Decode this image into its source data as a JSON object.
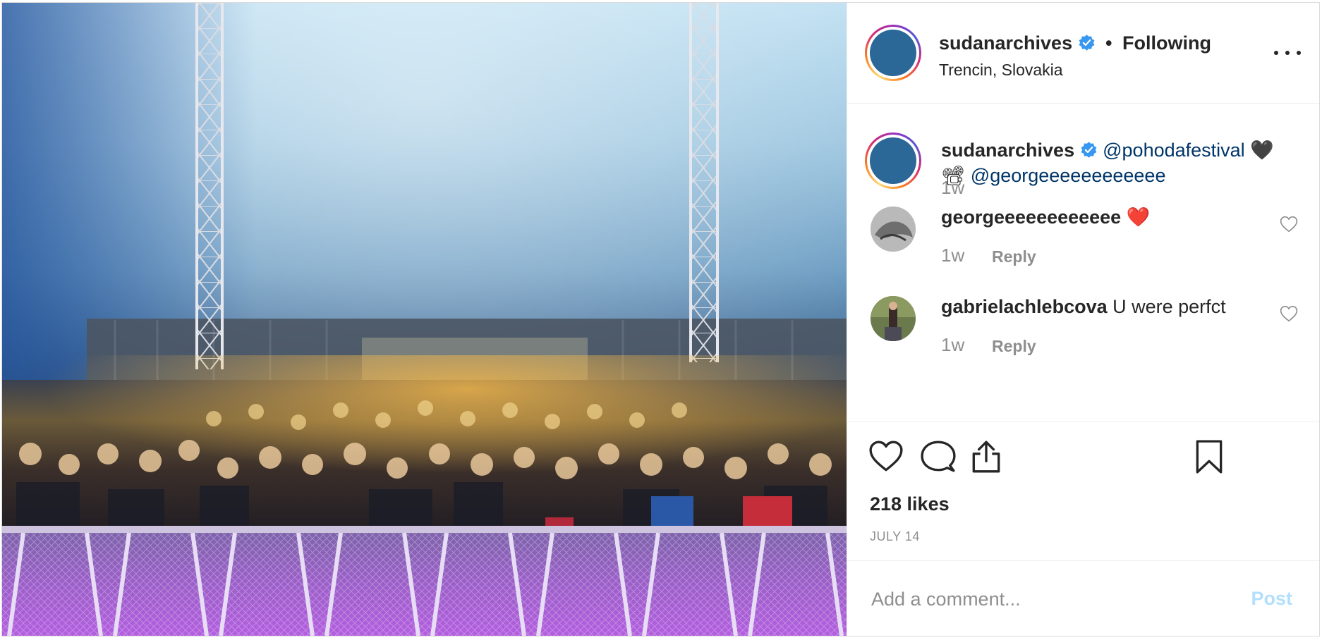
{
  "post": {
    "username": "sudanarchives",
    "verified_icon": "verified-badge-icon",
    "separator": "•",
    "follow_status": "Following",
    "location": "Trencin, Slovakia",
    "more_icon": "more-options-icon"
  },
  "caption": {
    "username": "sudanarchives",
    "mention_1": "@pohodafestival",
    "emoji_1": "🖤",
    "emoji_2": "📽",
    "mention_2": "@georgeeeeeeeeeeee",
    "age": "1w"
  },
  "comments": [
    {
      "username": "georgeeeeeeeeeeee",
      "text": "❤️",
      "age": "1w",
      "reply_label": "Reply"
    },
    {
      "username": "gabrielachlebcova",
      "text": "U were perfct",
      "age": "1w",
      "reply_label": "Reply"
    }
  ],
  "actions": {
    "like_icon": "heart-icon",
    "comment_icon": "comment-bubble-icon",
    "share_icon": "share-icon",
    "save_icon": "bookmark-icon"
  },
  "likes": "218 likes",
  "date": "JULY 14",
  "add_comment": {
    "placeholder": "Add a comment...",
    "post_label": "Post"
  },
  "colors": {
    "text": "#262626",
    "secondary": "#8e8e8e",
    "mention": "#003569",
    "verified": "#3897f0",
    "heart": "#ed4956",
    "post_disabled": "#b2dffc",
    "avatar": "#2b6797"
  }
}
